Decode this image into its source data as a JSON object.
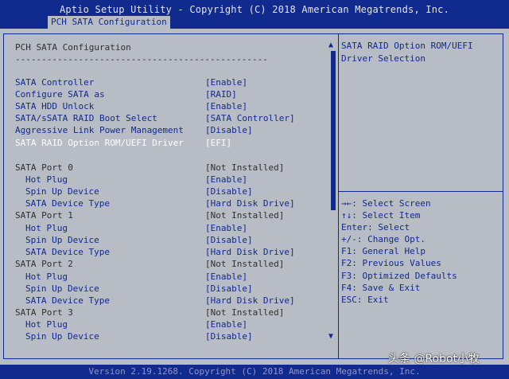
{
  "title": "Aptio Setup Utility - Copyright (C) 2018 American Megatrends, Inc.",
  "tab_label": "PCH SATA Configuration",
  "section_title": "PCH SATA Configuration",
  "separator": "------------------------------------------------",
  "settings": [
    {
      "label": "SATA Controller",
      "value": "[Enable]"
    },
    {
      "label": "Configure SATA as",
      "value": "[RAID]"
    },
    {
      "label": "SATA HDD Unlock",
      "value": "[Enable]"
    },
    {
      "label": "SATA/sSATA RAID Boot Select",
      "value": "[SATA Controller]"
    },
    {
      "label": "Aggressive Link Power Management",
      "value": "[Disable]"
    },
    {
      "label": "SATA RAID Option ROM/UEFI Driver",
      "value": "[EFI]"
    }
  ],
  "ports": [
    {
      "label": "SATA Port 0",
      "value": "[Not Installed]"
    },
    {
      "label": "Hot Plug",
      "value": "[Enable]"
    },
    {
      "label": "Spin Up Device",
      "value": "[Disable]"
    },
    {
      "label": "SATA Device Type",
      "value": "[Hard Disk Drive]"
    },
    {
      "label": "SATA Port 1",
      "value": "[Not Installed]"
    },
    {
      "label": "Hot Plug",
      "value": "[Enable]"
    },
    {
      "label": "Spin Up Device",
      "value": "[Disable]"
    },
    {
      "label": "SATA Device Type",
      "value": "[Hard Disk Drive]"
    },
    {
      "label": "SATA Port 2",
      "value": "[Not Installed]"
    },
    {
      "label": "Hot Plug",
      "value": "[Enable]"
    },
    {
      "label": "Spin Up Device",
      "value": "[Disable]"
    },
    {
      "label": "SATA Device Type",
      "value": "[Hard Disk Drive]"
    },
    {
      "label": "SATA Port 3",
      "value": "[Not Installed]"
    },
    {
      "label": "Hot Plug",
      "value": "[Enable]"
    },
    {
      "label": "Spin Up Device",
      "value": "[Disable]"
    }
  ],
  "help": [
    "SATA RAID Option ROM/UEFI",
    "Driver Selection"
  ],
  "keys": [
    "→←: Select Screen",
    "↑↓: Select Item",
    "Enter: Select",
    "+/-: Change Opt.",
    "F1: General Help",
    "F2: Previous Values",
    "F3: Optimized Defaults",
    "F4: Save & Exit",
    "ESC: Exit"
  ],
  "footer": "Version 2.19.1268. Copyright (C) 2018 American Megatrends, Inc.",
  "watermark": "头条 @Robot小牧",
  "icons": {
    "scroll_up": "▲",
    "scroll_down": "▼"
  },
  "colors": {
    "bar": "#102a8e",
    "panel": "#b8bcc4",
    "selected": "#ffffff"
  }
}
